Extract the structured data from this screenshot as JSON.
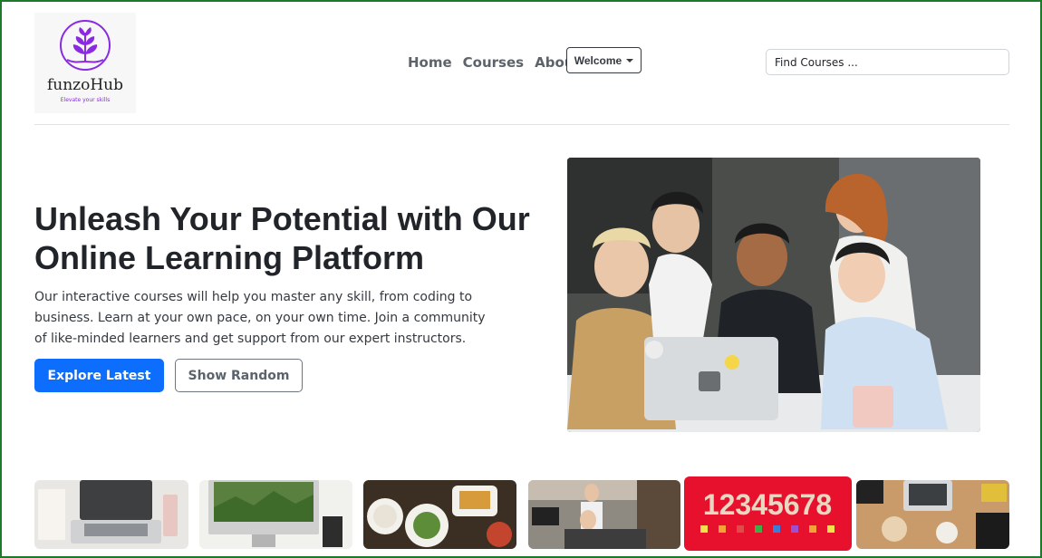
{
  "brand": {
    "name": "funzoHub",
    "tagline": "Elevate your skills"
  },
  "nav": {
    "items": [
      "Home",
      "Courses",
      "About"
    ],
    "welcome": "Welcome"
  },
  "search": {
    "placeholder": "Find Courses ..."
  },
  "hero": {
    "title": "Unleash Your Potential with Our Online Learning Platform",
    "text": "Our interactive courses will help you master any skill, from coding to business. Learn at your own pace, on your own time. Join a community of like-minded learners and get support from our expert instructors.",
    "primary_button": "Explore Latest",
    "secondary_button": "Show Random"
  },
  "thumbnails": [
    "laptop-desk-image",
    "imac-workspace-image",
    "food-table-image",
    "office-team-image",
    "numbers-image",
    "desk-flatlay-image"
  ],
  "thumbnail_text": "12345678",
  "colors": {
    "accent": "#0d6efd",
    "logo": "#8a2be2",
    "numbers_bg": "#e8112d"
  }
}
